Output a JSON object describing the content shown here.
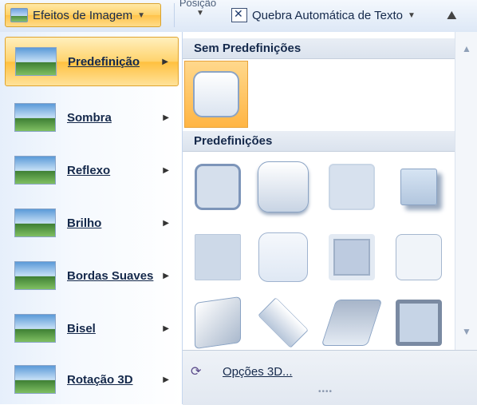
{
  "ribbon": {
    "image_effects_label": "Efeitos de Imagem",
    "position_label": "Posição",
    "text_wrap_label": "Quebra Automática de Texto"
  },
  "effects_menu": {
    "items": [
      {
        "label": "Predefinição",
        "active": true
      },
      {
        "label": "Sombra"
      },
      {
        "label": "Reflexo"
      },
      {
        "label": "Brilho"
      },
      {
        "label": "Bordas Suaves"
      },
      {
        "label": "Bisel"
      },
      {
        "label": "Rotação 3D"
      }
    ]
  },
  "gallery": {
    "no_presets_header": "Sem Predefinições",
    "presets_header": "Predefinições",
    "options_3d_label": "Opções 3D..."
  },
  "colors": {
    "accent_orange": "#ffc34a",
    "text_navy": "#15294b",
    "menu_bg_blue": "#e6effb"
  }
}
